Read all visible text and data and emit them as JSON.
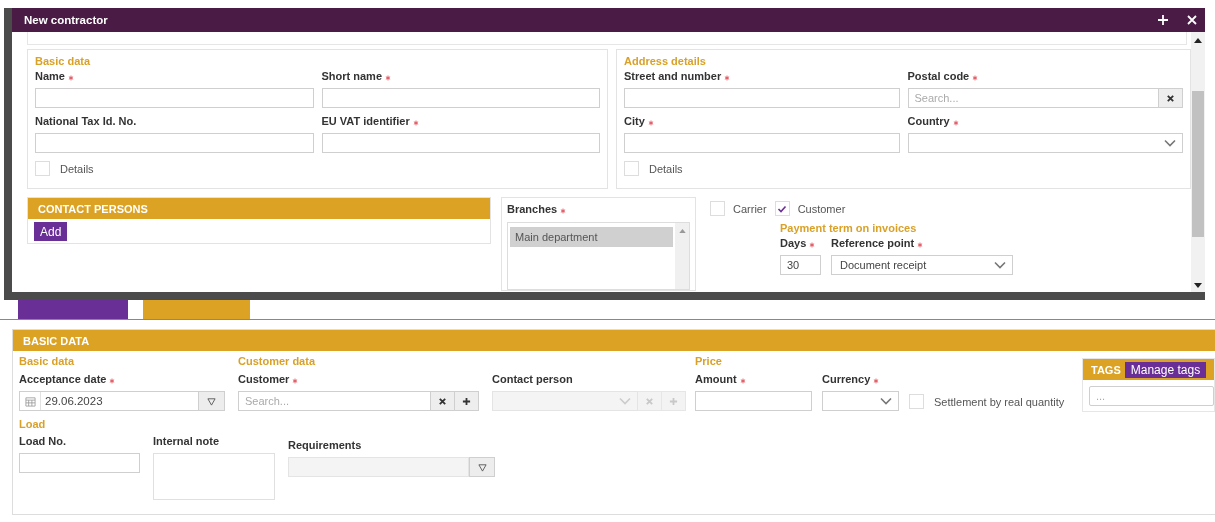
{
  "dialog": {
    "title": "New contractor",
    "basic_data": {
      "heading": "Basic data",
      "fields": [
        {
          "label": "Name",
          "required": true,
          "kind": "text"
        },
        {
          "label": "Short name",
          "required": true,
          "kind": "text"
        },
        {
          "label": "National Tax Id. No.",
          "required": false,
          "kind": "text"
        },
        {
          "label": "EU VAT identifier",
          "required": true,
          "kind": "text"
        }
      ],
      "details": {
        "label": "Details",
        "checked": false
      }
    },
    "address_details": {
      "heading": "Address details",
      "fields": [
        {
          "label": "Street and number",
          "required": true,
          "kind": "text"
        },
        {
          "label": "Postal code",
          "required": true,
          "kind": "search",
          "placeholder": "Search...",
          "clear": true
        },
        {
          "label": "City",
          "required": true,
          "kind": "text"
        },
        {
          "label": "Country",
          "required": true,
          "kind": "select"
        }
      ],
      "details": {
        "label": "Details",
        "checked": false
      }
    },
    "contact_persons": {
      "heading": "CONTACT PERSONS",
      "add_button": "Add"
    },
    "branches": {
      "label": "Branches",
      "required": true,
      "items": [
        {
          "label": "Main department",
          "selected": true
        }
      ]
    },
    "roles": [
      {
        "label": "Carrier",
        "checked": false
      },
      {
        "label": "Customer",
        "checked": true
      }
    ],
    "payment_term": {
      "heading": "Payment term on invoices",
      "fields": [
        {
          "label": "Days",
          "required": true,
          "kind": "text",
          "value": "30"
        },
        {
          "label": "Reference point",
          "required": true,
          "kind": "select",
          "value": "Document receipt"
        }
      ]
    }
  },
  "page": {
    "section_title": "BASIC DATA",
    "basic_data": {
      "heading": "Basic data",
      "fields": [
        {
          "label": "Acceptance date",
          "required": true,
          "kind": "date",
          "value": "29.06.2023"
        }
      ]
    },
    "customer_data": {
      "heading": "Customer data",
      "fields": [
        {
          "label": "Customer",
          "required": true,
          "kind": "search",
          "placeholder": "Search...",
          "clear": true,
          "add": true
        },
        {
          "label": "Contact person",
          "required": false,
          "kind": "select",
          "disabled": true,
          "clear": true,
          "add": true
        }
      ]
    },
    "price": {
      "heading": "Price",
      "fields": [
        {
          "label": "Amount",
          "required": true,
          "kind": "text"
        },
        {
          "label": "Currency",
          "required": true,
          "kind": "select"
        }
      ],
      "settlement": {
        "label": "Settlement by real quantity",
        "checked": false
      }
    },
    "tags": {
      "heading": "TAGS",
      "button": "Manage tags",
      "placeholder": "..."
    },
    "load": {
      "heading": "Load",
      "fields": [
        {
          "label": "Load No.",
          "required": false,
          "kind": "text"
        },
        {
          "label": "Internal note",
          "required": false,
          "kind": "textarea"
        },
        {
          "label": "Requirements",
          "required": false,
          "kind": "filter",
          "disabled": true
        }
      ]
    }
  }
}
